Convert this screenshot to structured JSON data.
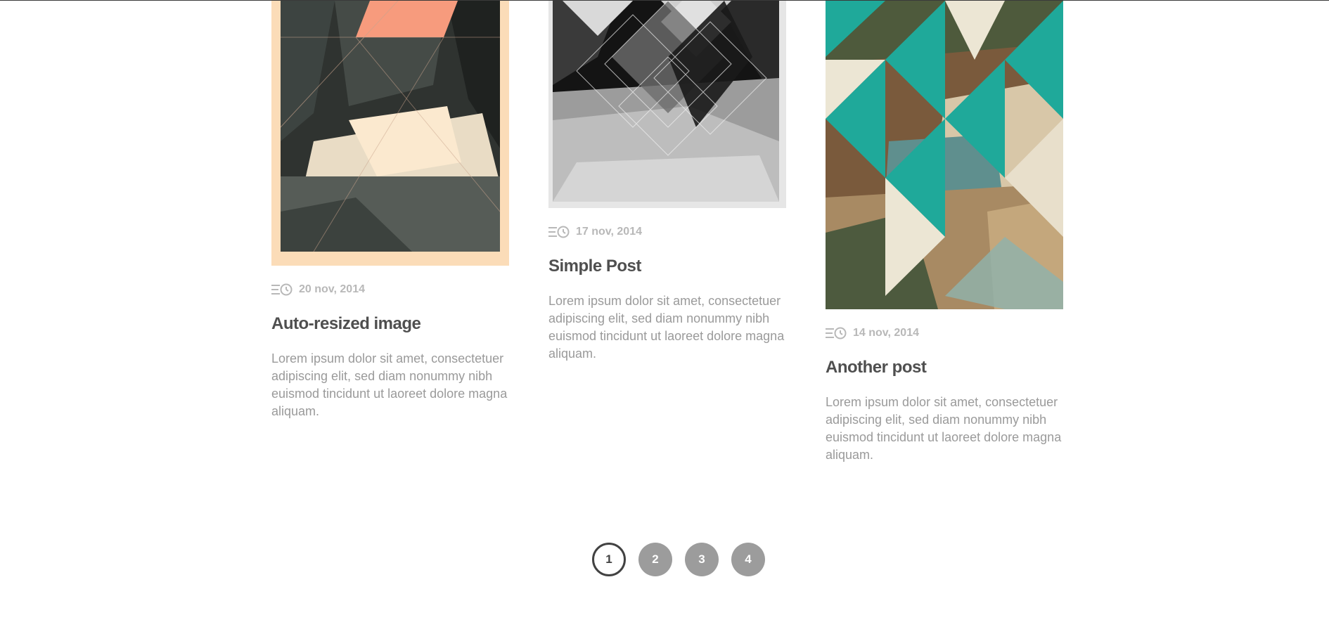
{
  "posts": [
    {
      "date": "20 nov, 2014",
      "title": "Auto-resized image",
      "excerpt": "Lorem ipsum dolor sit amet, consectetuer adipiscing elit, sed diam nonummy nibh euismod tincidunt ut laoreet dolore magna aliquam.",
      "date_icon": "calendar-clock-icon"
    },
    {
      "date": "17 nov, 2014",
      "title": "Simple Post",
      "excerpt": "Lorem ipsum dolor sit amet, consectetuer adipiscing elit, sed diam nonummy nibh euismod tincidunt ut laoreet dolore magna aliquam.",
      "date_icon": "calendar-clock-icon"
    },
    {
      "date": "14 nov, 2014",
      "title": "Another post",
      "excerpt": "Lorem ipsum dolor sit amet, consectetuer adipiscing elit, sed diam nonummy nibh euismod tincidunt ut laoreet dolore magna aliquam.",
      "date_icon": "calendar-clock-icon"
    }
  ],
  "pagination": {
    "pages": [
      "1",
      "2",
      "3",
      "4"
    ],
    "current": "1"
  },
  "colors": {
    "title": "#4f4f4f",
    "meta": "#b8b8b8",
    "excerpt": "#9a9a9a",
    "page_active_border": "#424242",
    "page_inactive_bg": "#9c9c9c",
    "teal_accent": "#1fa99a",
    "salmon_accent": "#f79b7d",
    "cream_border": "#fbdcb8"
  }
}
